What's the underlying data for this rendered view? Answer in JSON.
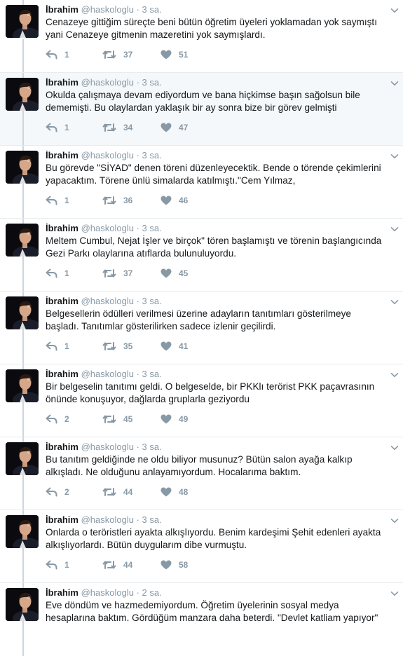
{
  "tweets": [
    {
      "name": "İbrahim",
      "handle": "@haskologlu",
      "time": "3 sa.",
      "line1": "Cenazeye gittiğim süreçte beni bütün öğretim üyeleri yoklamadan yok saymıştı",
      "line2": "yani Cenazeye gitmenin mazeretini yok saymışlardı.",
      "replies": "1",
      "retweets": "37",
      "likes": "51",
      "highlighted": false
    },
    {
      "name": "İbrahim",
      "handle": "@haskologlu",
      "time": "3 sa.",
      "line1": "Okulda çalışmaya devam ediyordum ve bana hiçkimse başın sağolsun bile",
      "line2": "dememişti. Bu olaylardan yaklaşık bir ay sonra bize bir görev gelmişti",
      "replies": "1",
      "retweets": "34",
      "likes": "47",
      "highlighted": true
    },
    {
      "name": "İbrahim",
      "handle": "@haskologlu",
      "time": "3 sa.",
      "line1": "Bu görevde \"SİYAD\" denen töreni düzenleyecektik. Bende o törende çekimlerini",
      "line2": "yapacaktım. Törene ünlü simalarda katılmıştı.\"Cem Yılmaz,",
      "replies": "1",
      "retweets": "36",
      "likes": "46",
      "highlighted": false
    },
    {
      "name": "İbrahim",
      "handle": "@haskologlu",
      "time": "3 sa.",
      "line1": "Meltem Cumbul, Nejat İşler ve birçok\" tören başlamıştı ve törenin başlangıcında",
      "line2": "Gezi Parkı olaylarına atıflarda bulunuluyordu.",
      "replies": "1",
      "retweets": "37",
      "likes": "45",
      "highlighted": false
    },
    {
      "name": "İbrahim",
      "handle": "@haskologlu",
      "time": "3 sa.",
      "line1": "Belgesellerin ödülleri verilmesi üzerine adayların tanıtımları gösterilmeye",
      "line2": "başladı. Tanıtımlar gösterilirken sadece izlenir geçilirdi.",
      "replies": "1",
      "retweets": "35",
      "likes": "41",
      "highlighted": false
    },
    {
      "name": "İbrahim",
      "handle": "@haskologlu",
      "time": "3 sa.",
      "line1": "Bir belgeselin tanıtımı geldi. O belgeselde, bir PKKlı terörist PKK paçavrasının",
      "line2": "önünde konuşuyor, dağlarda gruplarla geziyordu",
      "replies": "2",
      "retweets": "45",
      "likes": "49",
      "highlighted": false
    },
    {
      "name": "İbrahim",
      "handle": "@haskologlu",
      "time": "3 sa.",
      "line1": "Bu tanıtım geldiğinde ne oldu biliyor musunuz? Bütün salon ayağa kalkıp",
      "line2": "alkışladı. Ne olduğunu anlayamıyordum. Hocalarıma baktım.",
      "replies": "2",
      "retweets": "44",
      "likes": "48",
      "highlighted": false
    },
    {
      "name": "İbrahim",
      "handle": "@haskologlu",
      "time": "3 sa.",
      "line1": "Onlarda o teröristleri ayakta alkışlıyordu. Benim kardeşimi Şehit edenleri ayakta",
      "line2": "alkışlıyorlardı. Bütün duygularım dibe vurmuştu.",
      "replies": "1",
      "retweets": "44",
      "likes": "58",
      "highlighted": false
    },
    {
      "name": "İbrahim",
      "handle": "@haskologlu",
      "time": "2 sa.",
      "line1": "Eve döndüm ve hazmedemiyordum. Öğretim üyelerinin sosyal medya",
      "line2": "hesaplarına baktım. Gördüğüm manzara daha beterdi. \"Devlet katliam yapıyor\"",
      "replies": "",
      "retweets": "",
      "likes": "",
      "highlighted": false
    }
  ],
  "icons": {
    "reply": "reply-arrow",
    "retweet": "retweet-arrows",
    "like": "heart",
    "more": "chevron-down"
  },
  "colors": {
    "text": "#14171a",
    "muted": "#8899a6",
    "thread": "#ccd6dd",
    "highlight_bg": "#f5f8fa",
    "divider": "#e6ecf0"
  }
}
